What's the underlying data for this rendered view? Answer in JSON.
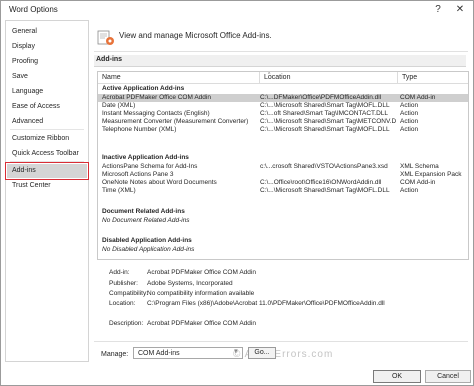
{
  "window": {
    "title": "Word Options",
    "help": "?",
    "close": "✕"
  },
  "sidebar": {
    "items": [
      {
        "label": "General"
      },
      {
        "label": "Display"
      },
      {
        "label": "Proofing"
      },
      {
        "label": "Save"
      },
      {
        "label": "Language"
      },
      {
        "label": "Ease of Access"
      },
      {
        "label": "Advanced"
      },
      {
        "label": "Customize Ribbon"
      },
      {
        "label": "Quick Access Toolbar"
      },
      {
        "label": "Add-ins"
      },
      {
        "label": "Trust Center"
      }
    ],
    "selected": "Add-ins"
  },
  "header": {
    "text": "View and manage Microsoft Office Add-ins."
  },
  "section": {
    "title": "Add-ins"
  },
  "table": {
    "columns": [
      "Name",
      "Location",
      "Type"
    ],
    "sort_indicator": "^",
    "groups": [
      {
        "title": "Active Application Add-ins",
        "rows": [
          [
            "Acrobat PDFMaker Office COM Addin",
            "C:\\...DFMaker\\Office\\PDFMOfficeAddin.dll",
            "COM Add-in"
          ],
          [
            "Date (XML)",
            "C:\\...\\Microsoft Shared\\Smart Tag\\MOFL.DLL",
            "Action"
          ],
          [
            "Instant Messaging Contacts (English)",
            "C:\\...oft Shared\\Smart Tag\\IMCONTACT.DLL",
            "Action"
          ],
          [
            "Measurement Converter (Measurement Converter)",
            "C:\\...\\Microsoft Shared\\Smart Tag\\METCONV.DLL",
            "Action"
          ],
          [
            "Telephone Number (XML)",
            "C:\\...\\Microsoft Shared\\Smart Tag\\MOFL.DLL",
            "Action"
          ]
        ]
      },
      {
        "title": "Inactive Application Add-ins",
        "rows": [
          [
            "ActionsPane Schema for Add-Ins",
            "c:\\...crosoft Shared\\VSTO\\ActionsPane3.xsd",
            "XML Schema"
          ],
          [
            "Microsoft Actions Pane 3",
            "",
            "XML Expansion Pack"
          ],
          [
            "OneNote Notes about Word Documents",
            "C:\\...Office\\root\\Office16\\ONWordAddin.dll",
            "COM Add-in"
          ],
          [
            "Time (XML)",
            "C:\\...\\Microsoft Shared\\Smart Tag\\MOFL.DLL",
            "Action"
          ]
        ]
      },
      {
        "title": "Document Related Add-ins",
        "rows": [
          [
            "No Document Related Add-ins",
            "",
            ""
          ]
        ]
      },
      {
        "title": "Disabled Application Add-ins",
        "rows": [
          [
            "No Disabled Application Add-ins",
            "",
            ""
          ]
        ]
      }
    ]
  },
  "details": {
    "addin_label": "Add-in:",
    "addin_value": "Acrobat PDFMaker Office COM Addin",
    "publisher_label": "Publisher:",
    "publisher_value": "Adobe Systems, Incorporated",
    "compat_label": "Compatibility:",
    "compat_value": "No compatibility information available",
    "location_label": "Location:",
    "location_value": "C:\\Program Files (x86)\\Adobe\\Acrobat 11.0\\PDFMaker\\Office\\PDFMOfficeAddin.dll",
    "desc_label": "Description:",
    "desc_value": "Acrobat PDFMaker Office COM Addin"
  },
  "footer": {
    "manage_label": "Manage:",
    "manage_value": "COM Add-ins",
    "go_label": "Go...",
    "ok_label": "OK",
    "cancel_label": "Cancel",
    "watermark": "© AvoidErrors.com"
  }
}
